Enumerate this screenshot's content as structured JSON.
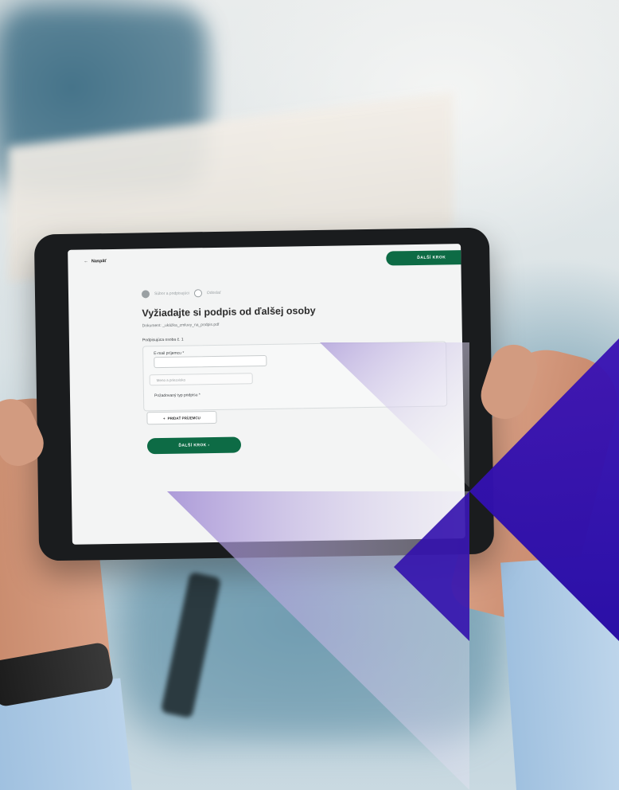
{
  "app": {
    "back_label": "Naspäť",
    "next_top_label": "ĎALŠÍ KROK",
    "steps": [
      "Súbor a podpisujúci",
      "Odoslať"
    ],
    "title": "Vyžiadajte si podpis od ďalšej osoby",
    "document_line": "Dokument: _ukážka_zmluvy_na_podpis.pdf",
    "signer_label": "Podpisujúca osoba č. 1",
    "email_label": "E-mail príjemcu *",
    "nickname_placeholder": "Meno a priezvisko",
    "signature_type_label": "Požadovaný typ podpisu *",
    "add_signer_label": "PRIDAŤ PRÍJEMCU",
    "next_bottom_label": "ĎALŠÍ KROK ›"
  },
  "colors": {
    "accent_green": "#0d6b45",
    "overlay_purple": "#2a0fa6",
    "overlay_lilac": "#b9acd9"
  },
  "icons": [
    "back-arrow-icon",
    "plus-icon",
    "step-radio-icon"
  ]
}
